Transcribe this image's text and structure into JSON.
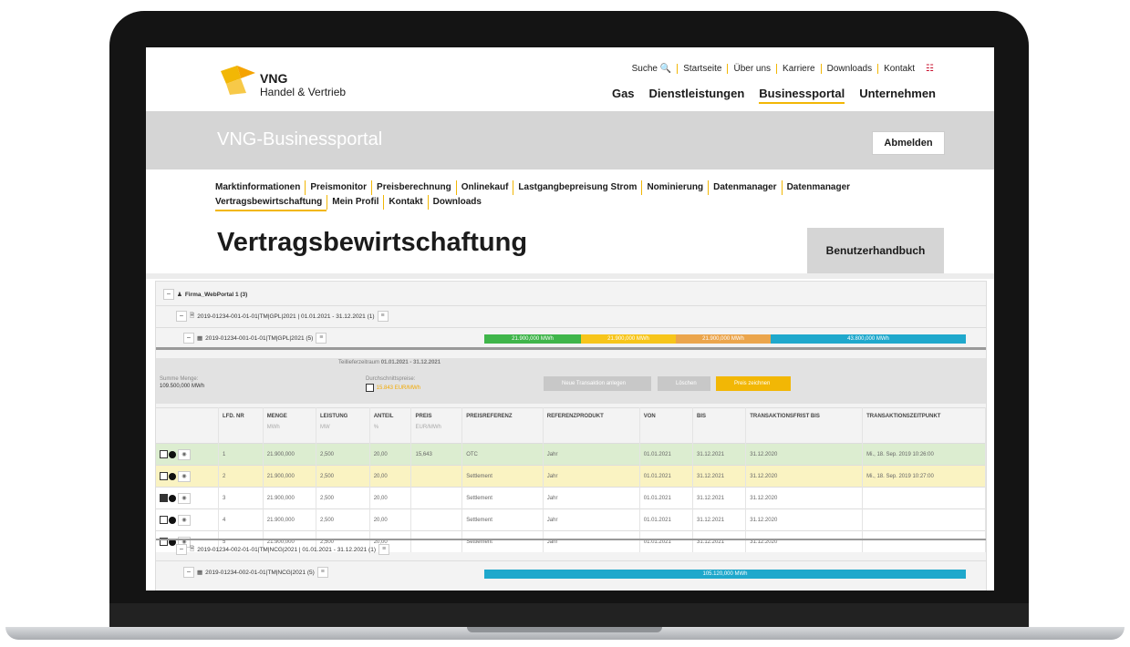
{
  "header": {
    "brand": "VNG",
    "brand_sub": "Handel & Vertrieb",
    "util_links": [
      "Suche",
      "Startseite",
      "Über uns",
      "Karriere",
      "Downloads",
      "Kontakt"
    ],
    "main_nav": [
      "Gas",
      "Dienstleistungen",
      "Businessportal",
      "Unternehmen"
    ]
  },
  "band": {
    "title": "VNG-Businessportal",
    "logout": "Abmelden"
  },
  "subnav": {
    "items": [
      "Marktinformationen",
      "Preismonitor",
      "Preisberechnung",
      "Onlinekauf",
      "Lastgangbepreisung Strom",
      "Nominierung",
      "Datenmanager",
      "Datenmanager",
      "Vertragsbewirtschaftung",
      "Mein Profil",
      "Kontakt",
      "Downloads"
    ]
  },
  "page": {
    "title": "Vertragsbewirtschaftung",
    "manual_button": "Benutzerhandbuch"
  },
  "tree": {
    "company": "Firma_WebPortal 1 (3)",
    "contract1": "2019-01234-001-01-01|TM|GPL|2021 | 01.01.2021 - 31.12.2021 (1)",
    "position1": "2019-01234-001-01-01|TM|GPL|2021 (5)",
    "segments1": [
      "21.900,000 MWh",
      "21.900,000 MWh",
      "21.900,000 MWh",
      "43.800,000 MWh"
    ],
    "colors": {
      "green": "#3fb54a",
      "yellow": "#f7c51a",
      "orange": "#eba54c",
      "blue": "#1fa8cc"
    },
    "contract2": "2019-01234-002-01-01|TM|NCG|2021 | 01.01.2021 - 31.12.2021 (1)",
    "position2": "2019-01234-002-01-01|TM|NCG|2021 (5)",
    "segment2": "105.120,000 MWh"
  },
  "panel": {
    "period_label": "Teillieferzeitraum",
    "period_value": "01.01.2021 - 31.12.2021",
    "sum_label": "Summe Menge:",
    "sum_value": "109.500,000 MWh",
    "avg_label": "Durchschnittspreise:",
    "avg_value": "15.843 EUR/MWh",
    "btn_new": "Neue Transaktion anlegen",
    "btn_delete": "Löschen",
    "btn_price": "Preis zeichnen"
  },
  "table": {
    "headers": [
      {
        "label": "LFD. NR",
        "unit": ""
      },
      {
        "label": "MENGE",
        "unit": "MWh"
      },
      {
        "label": "LEISTUNG",
        "unit": "MW"
      },
      {
        "label": "ANTEIL",
        "unit": "%"
      },
      {
        "label": "PREIS",
        "unit": "EUR/MWh"
      },
      {
        "label": "PREISREFERENZ",
        "unit": ""
      },
      {
        "label": "REFERENZPRODUKT",
        "unit": ""
      },
      {
        "label": "VON",
        "unit": ""
      },
      {
        "label": "BIS",
        "unit": ""
      },
      {
        "label": "TRANSAKTIONSFRIST BIS",
        "unit": ""
      },
      {
        "label": "TRANSAKTIONSZEITPUNKT",
        "unit": ""
      }
    ],
    "rows": [
      {
        "state": "g",
        "checked": false,
        "cells": [
          "1",
          "21.900,000",
          "2,500",
          "20,00",
          "15,643",
          "OTC",
          "Jahr",
          "01.01.2021",
          "31.12.2021",
          "31.12.2020",
          "Mi., 18. Sep. 2019 10:26:00"
        ]
      },
      {
        "state": "y",
        "checked": false,
        "cells": [
          "2",
          "21.900,000",
          "2,500",
          "20,00",
          "",
          "Settlement",
          "Jahr",
          "01.01.2021",
          "31.12.2021",
          "31.12.2020",
          "Mi., 18. Sep. 2019 10:27:00"
        ]
      },
      {
        "state": "w",
        "checked": true,
        "cells": [
          "3",
          "21.900,000",
          "2,500",
          "20,00",
          "",
          "Settlement",
          "Jahr",
          "01.01.2021",
          "31.12.2021",
          "31.12.2020",
          ""
        ]
      },
      {
        "state": "w",
        "checked": false,
        "cells": [
          "4",
          "21.900,000",
          "2,500",
          "20,00",
          "",
          "Settlement",
          "Jahr",
          "01.01.2021",
          "31.12.2021",
          "31.12.2020",
          ""
        ]
      },
      {
        "state": "w",
        "checked": false,
        "cells": [
          "5",
          "21.900,000",
          "2,500",
          "20,00",
          "",
          "Settlement",
          "Jahr",
          "01.01.2021",
          "31.12.2021",
          "31.12.2020",
          ""
        ]
      }
    ]
  }
}
